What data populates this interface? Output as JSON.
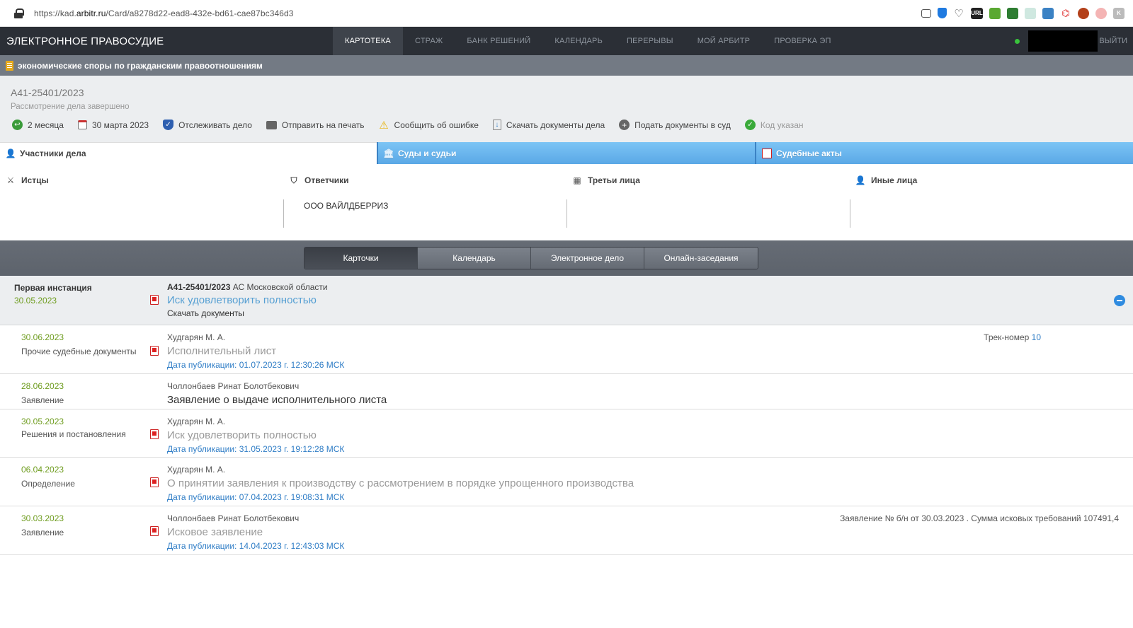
{
  "browser": {
    "url_prefix": "https://kad.",
    "url_domain": "arbitr.ru",
    "url_path": "/Card/a8278d22-ead8-432e-bd61-cae87bc346d3"
  },
  "nav": {
    "brand": "ЭЛЕКТРОННОЕ ПРАВОСУДИЕ",
    "items": [
      "КАРТОТЕКА",
      "СТРАЖ",
      "БАНК РЕШЕНИЙ",
      "КАЛЕНДАРЬ",
      "ПЕРЕРЫВЫ",
      "МОЙ АРБИТР",
      "ПРОВЕРКА ЭП"
    ],
    "logout": "ВЫЙТИ"
  },
  "category": "экономические споры по гражданским правоотношениям",
  "case": {
    "number": "А41-25401/2023",
    "status": "Рассмотрение дела завершено",
    "actions": {
      "duration": "2 месяца",
      "date": "30 марта 2023",
      "track": "Отслеживать дело",
      "print": "Отправить на печать",
      "report": "Сообщить об ошибке",
      "download": "Скачать документы дела",
      "submit": "Подать документы в суд",
      "code": "Код указан"
    }
  },
  "tabs": {
    "participants": "Участники дела",
    "courts": "Суды и судьи",
    "acts": "Судебные акты"
  },
  "participants": {
    "plaintiffs": {
      "title": "Истцы",
      "value": ""
    },
    "defendants": {
      "title": "Ответчики",
      "value": "ООО ВАЙЛДБЕРРИЗ"
    },
    "third": {
      "title": "Третьи лица",
      "value": ""
    },
    "other": {
      "title": "Иные лица",
      "value": ""
    }
  },
  "subtabs": [
    "Карточки",
    "Календарь",
    "Электронное дело",
    "Онлайн-заседания"
  ],
  "instance": {
    "title": "Первая инстанция",
    "date": "30.05.2023",
    "case_number": "А41-25401/2023",
    "court": "АС Московской области",
    "result": "Иск удовлетворить полностью",
    "download": "Скачать документы"
  },
  "documents": [
    {
      "date": "30.06.2023",
      "type": "Прочие судебные документы",
      "author": "Худгарян М. А.",
      "title": "Исполнительный лист",
      "pub": "Дата публикации: 01.07.2023 г. 12:30:26 МСК",
      "track_label": "Трек-номер ",
      "track_num": "10"
    },
    {
      "date": "28.06.2023",
      "type": "Заявление",
      "author": "Чоллонбаев Ринат Болотбекович",
      "title": "Заявление о выдаче исполнительного листа"
    },
    {
      "date": "30.05.2023",
      "type": "Решения и постановления",
      "author": "Худгарян М. А.",
      "title": "Иск удовлетворить полностью",
      "pub": "Дата публикации: 31.05.2023 г. 19:12:28 МСК"
    },
    {
      "date": "06.04.2023",
      "type": "Определение",
      "author": "Худгарян М. А.",
      "title": "О принятии заявления к производству с рассмотрением в порядке упрощенного производства",
      "pub": "Дата публикации: 07.04.2023 г. 19:08:31 МСК"
    },
    {
      "date": "30.03.2023",
      "type": "Заявление",
      "author": "Чоллонбаев Ринат Болотбекович",
      "title": "Исковое заявление",
      "pub": "Дата публикации: 14.04.2023 г. 12:43:03 МСК",
      "note": "Заявление № б/н от 30.03.2023 . Сумма исковых требований 107491,4"
    }
  ]
}
